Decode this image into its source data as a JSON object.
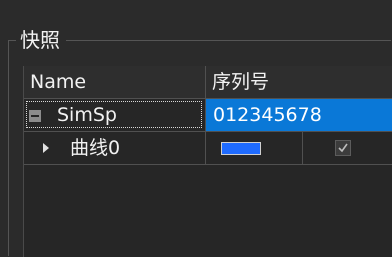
{
  "groupbox": {
    "title": "快照"
  },
  "tree": {
    "columns": [
      "Name",
      "序列号"
    ],
    "rows": [
      {
        "name": "SimSp",
        "serial": "012345678",
        "expanded": true,
        "selected": true,
        "children": [
          {
            "name": "曲线0",
            "color": "#1f6bff",
            "checked": true
          }
        ]
      }
    ]
  },
  "colors": {
    "background": "#2b2b2b",
    "selection": "#0a78d7",
    "swatch": "#1f6bff"
  },
  "icons": {
    "collapse": "minus-box-icon",
    "expand": "triangle-right-icon",
    "check": "checkmark-icon"
  }
}
